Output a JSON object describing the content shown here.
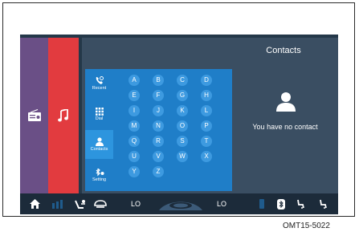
{
  "side": {
    "radio_icon": "radio-icon",
    "music_icon": "music-note-icon"
  },
  "tabs": [
    {
      "label": "Recent",
      "icon": "phone-recent-icon"
    },
    {
      "label": "Dial",
      "icon": "dialpad-icon"
    },
    {
      "label": "Contacts",
      "icon": "contacts-icon"
    },
    {
      "label": "Setting",
      "icon": "bluetooth-setting-icon"
    }
  ],
  "keypad": {
    "letters": [
      "A",
      "B",
      "C",
      "D",
      "E",
      "F",
      "G",
      "H",
      "I",
      "J",
      "K",
      "L",
      "M",
      "N",
      "O",
      "P",
      "Q",
      "R",
      "S",
      "T",
      "U",
      "V",
      "W",
      "X",
      "Y",
      "Z"
    ]
  },
  "contacts": {
    "title": "Contacts",
    "empty_message": "You have no contact"
  },
  "statusbar": {
    "left_temp": "LO",
    "right_temp": "LO",
    "icons": [
      "home-icon",
      "fan-icon",
      "seat-airflow-icon",
      "recirculation-icon",
      "climate-oval-icon",
      "seat-heat-icon",
      "bluetooth-icon",
      "seat-heater-left-icon",
      "seat-heater-right-icon"
    ]
  },
  "caption": "OMT15-5022",
  "colors": {
    "radio_strip": "#6a4f86",
    "music_strip": "#e23b3f",
    "panel": "#3a4e62",
    "keypad": "#1f7ec8",
    "statusbar": "#1c2b3a"
  }
}
